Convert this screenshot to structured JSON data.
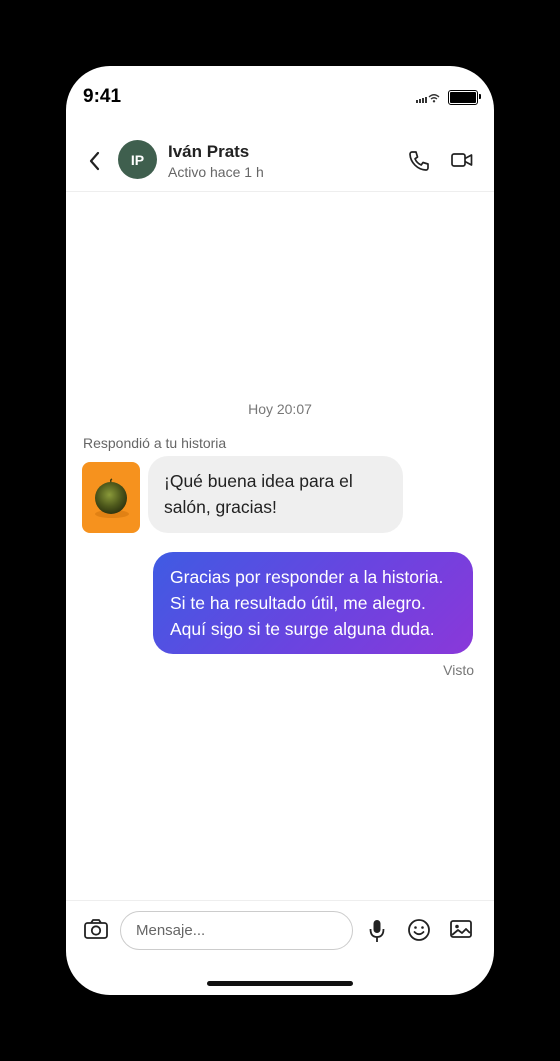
{
  "status_bar": {
    "time": "9:41"
  },
  "header": {
    "avatar_initials": "IP",
    "avatar_color": "#3f5f4e",
    "contact_name": "Iván Prats",
    "contact_status": "Activo hace 1 h",
    "icons": [
      "back-icon",
      "phone-icon",
      "video-camera-icon"
    ]
  },
  "chat": {
    "timestamp": "Hoy 20:07",
    "reply_label": "Respondió a tu historia",
    "received_message": "¡Qué buena idea para el salón, gracias!",
    "sent_message": "Gracias por responder a la historia. Si te ha resultado útil, me alegro. Aquí sigo si te surge alguna duda.",
    "seen_status": "Visto",
    "sent_gradient": [
      "#3f5be3",
      "#6a44e0",
      "#8a38d9"
    ]
  },
  "composer": {
    "placeholder": "Mensaje...",
    "icons": [
      "camera-icon",
      "microphone-icon",
      "emoji-icon",
      "image-icon"
    ]
  }
}
